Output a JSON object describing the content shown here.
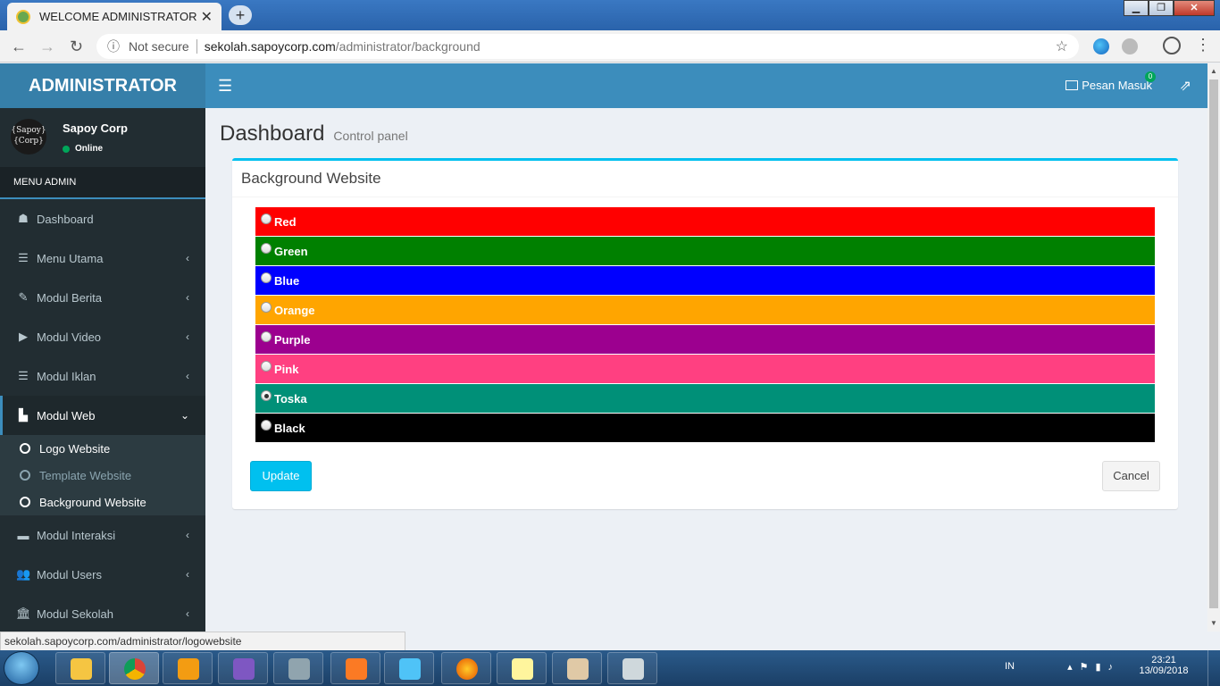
{
  "browser": {
    "tab_title": "WELCOME ADMINISTRATOR",
    "tab_close": "✕",
    "new_tab": "+",
    "security": "Not secure",
    "url_host": "sekolah.sapoycorp.com",
    "url_path": "/administrator/background",
    "status_url": "sekolah.sapoycorp.com/administrator/logowebsite"
  },
  "app": {
    "brand": "ADMINISTRATOR",
    "messages_label": "Pesan Masuk",
    "messages_count": "0"
  },
  "user": {
    "avatar_text_1": "{Sapoy}",
    "avatar_text_2": "{Corp}",
    "name": "Sapoy Corp",
    "status": "Online"
  },
  "sidebar": {
    "header": "MENU ADMIN",
    "items": [
      {
        "label": "Dashboard",
        "icon": "dashboard-icon",
        "glyph": "☗"
      },
      {
        "label": "Menu Utama",
        "icon": "list-icon",
        "glyph": "☰"
      },
      {
        "label": "Modul Berita",
        "icon": "pencil-icon",
        "glyph": "✎"
      },
      {
        "label": "Modul Video",
        "icon": "play-icon",
        "glyph": "▶"
      },
      {
        "label": "Modul Iklan",
        "icon": "list-icon",
        "glyph": "☰"
      },
      {
        "label": "Modul Web",
        "icon": "building-icon",
        "glyph": "▙"
      },
      {
        "label": "Modul Interaksi",
        "icon": "desktop-icon",
        "glyph": "▬"
      },
      {
        "label": "Modul Users",
        "icon": "users-icon",
        "glyph": "👥"
      },
      {
        "label": "Modul Sekolah",
        "icon": "bank-icon",
        "glyph": "🏛"
      }
    ],
    "submenu": [
      {
        "label": "Logo Website"
      },
      {
        "label": "Template Website"
      },
      {
        "label": "Background Website"
      }
    ]
  },
  "page": {
    "title": "Dashboard",
    "subtitle": "Control panel",
    "box_title": "Background Website",
    "colors": [
      {
        "label": "Red",
        "color": "#ff0000",
        "checked": false
      },
      {
        "label": "Green",
        "color": "#008000",
        "checked": false
      },
      {
        "label": "Blue",
        "color": "#0000ff",
        "checked": false
      },
      {
        "label": "Orange",
        "color": "#ffa500",
        "checked": false
      },
      {
        "label": "Purple",
        "color": "#9c008f",
        "checked": false
      },
      {
        "label": "Pink",
        "color": "#ff4081",
        "checked": false
      },
      {
        "label": "Toska",
        "color": "#009078",
        "checked": true
      },
      {
        "label": "Black",
        "color": "#000000",
        "checked": false
      }
    ],
    "update_label": "Update",
    "cancel_label": "Cancel"
  },
  "taskbar": {
    "lang": "IN",
    "time": "23:21",
    "date": "13/09/2018"
  }
}
